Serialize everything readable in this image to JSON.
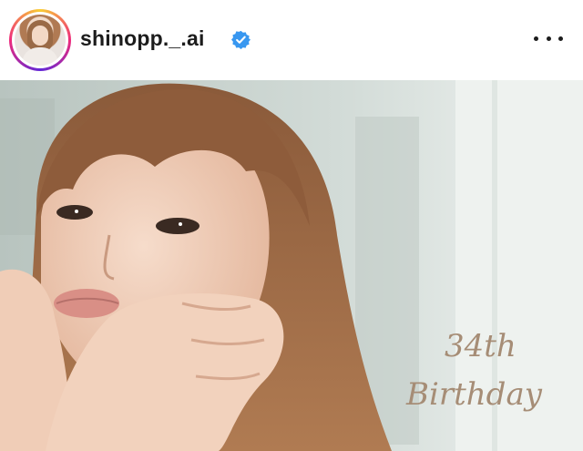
{
  "post": {
    "username": "shinopp._.ai",
    "verified": true,
    "more_icon": "more-horizontal-icon",
    "photo_caption_line1": "34th",
    "photo_caption_line2": "Birthday"
  },
  "colors": {
    "text": "#1c1c1c",
    "verified_badge": "#3897f0",
    "caption_text": "#a68d76"
  }
}
